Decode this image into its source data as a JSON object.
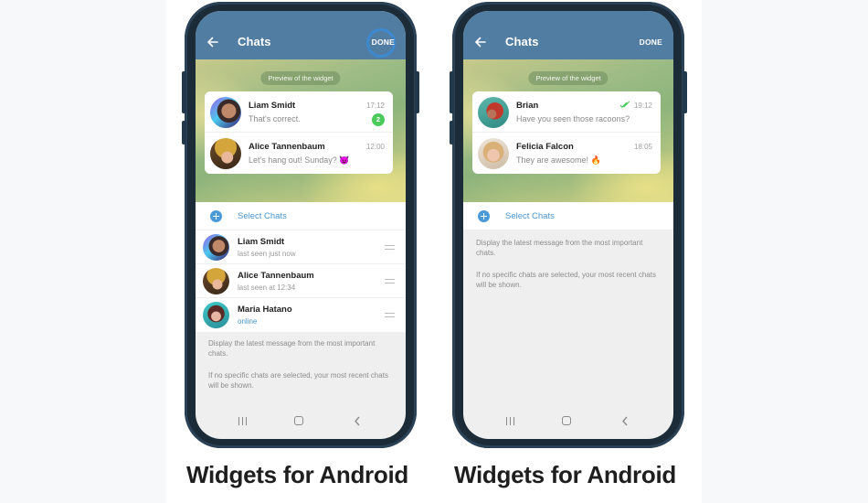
{
  "colors": {
    "header": "#527da3",
    "accent_blue": "#4a95cf",
    "unread_badge": "#4cca5c",
    "phone_frame": "#1c2b38",
    "done_highlight_ring": "#3a8bd4"
  },
  "phones": [
    {
      "header": {
        "back_icon": "arrow-left-icon",
        "title": "Chats",
        "done_label": "DONE",
        "done_highlighted": true
      },
      "preview_label": "Preview of the widget",
      "widget_rows": [
        {
          "name": "Liam Smidt",
          "message": "That's correct.",
          "time": "17:12",
          "unread_count": "2",
          "avatar": "liam-avatar"
        },
        {
          "name": "Alice Tannenbaum",
          "message": "Let's hang out! Sunday?",
          "emoji": "😈",
          "time": "12:00",
          "avatar": "alice-avatar"
        }
      ],
      "select_chats": {
        "icon": "plus-circle-icon",
        "label": "Select Chats"
      },
      "chat_list": [
        {
          "name": "Liam Smidt",
          "status": "last seen just now",
          "online": false
        },
        {
          "name": "Alice Tannenbaum",
          "status": "last seen at 12:34",
          "online": false
        },
        {
          "name": "Maria Hatano",
          "status": "online",
          "online": true
        }
      ],
      "info": [
        "Display the latest message from the most important chats.",
        "If no specific chats are selected, your most recent chats will be shown."
      ],
      "nav": {
        "recents_icon": "recents-icon",
        "home_icon": "home-icon",
        "back_icon": "chevron-left-icon"
      }
    },
    {
      "header": {
        "back_icon": "arrow-left-icon",
        "title": "Chats",
        "done_label": "DONE",
        "done_highlighted": false
      },
      "preview_label": "Preview of the widget",
      "widget_rows": [
        {
          "name": "Brian",
          "message": "Have you seen those racoons?",
          "time": "19:12",
          "read_receipt": "double-check-icon",
          "avatar": "brian-avatar"
        },
        {
          "name": "Felicia Falcon",
          "message": "They are awesome!",
          "emoji": "🔥",
          "time": "18:05",
          "avatar": "felicia-avatar"
        }
      ],
      "select_chats": {
        "icon": "plus-circle-icon",
        "label": "Select Chats"
      },
      "info": [
        "Display the latest message from the most important chats.",
        "If no specific chats are selected, your most recent chats will be shown."
      ],
      "nav": {
        "recents_icon": "recents-icon",
        "home_icon": "home-icon",
        "back_icon": "chevron-left-icon"
      }
    }
  ],
  "captions": [
    "Widgets for Android",
    "Widgets for Android"
  ]
}
